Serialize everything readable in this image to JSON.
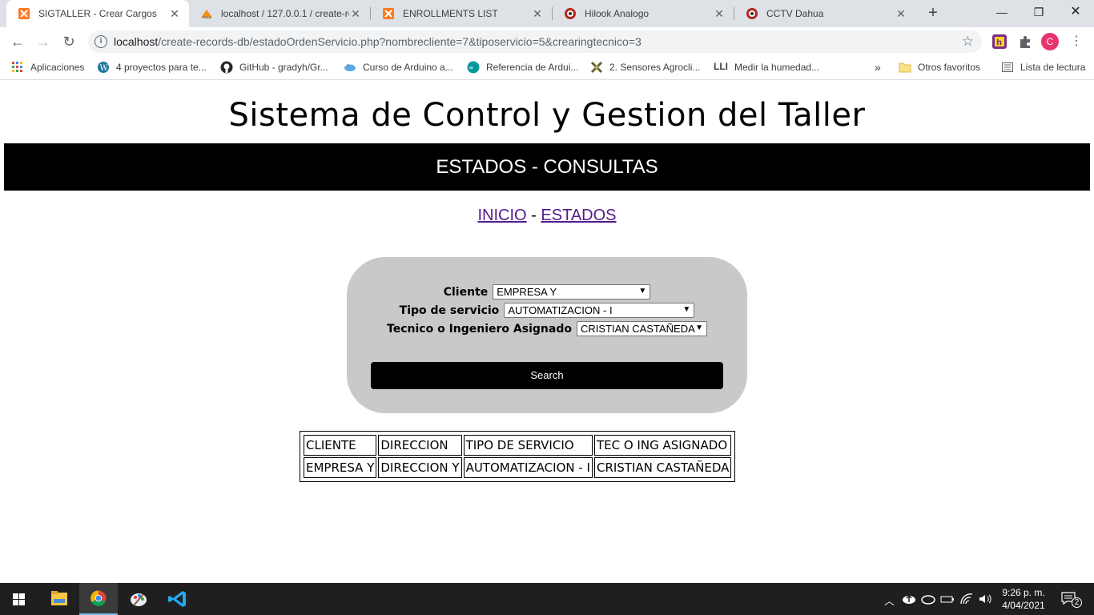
{
  "browser": {
    "tabs": [
      {
        "title": "SIGTALLER - Crear Cargos",
        "active": true,
        "icon": "xampp-icon"
      },
      {
        "title": "localhost / 127.0.0.1 / create-re",
        "active": false,
        "icon": "phpmyadmin-icon"
      },
      {
        "title": "ENROLLMENTS LIST",
        "active": false,
        "icon": "xampp-icon"
      },
      {
        "title": "Hilook Analogo",
        "active": false,
        "icon": "hikvision-icon"
      },
      {
        "title": "CCTV Dahua",
        "active": false,
        "icon": "hikvision-icon"
      }
    ],
    "url_host": "localhost",
    "url_path": "/create-records-db/estadoOrdenServicio.php?nombrecliente=7&tiposervicio=5&crearingtecnico=3",
    "profile_initial": "C",
    "bookmarks": [
      {
        "label": "Aplicaciones",
        "icon": "apps-grid-icon"
      },
      {
        "label": "4 proyectos para te...",
        "icon": "wordpress-icon"
      },
      {
        "label": "GitHub - gradyh/Gr...",
        "icon": "github-icon"
      },
      {
        "label": "Curso de Arduino a...",
        "icon": "cloud-link-icon"
      },
      {
        "label": "Referencia de Ardui...",
        "icon": "arduino-icon"
      },
      {
        "label": "2. Sensores Agrocli...",
        "icon": "sensor-icon"
      },
      {
        "label": "Medir la humedad...",
        "icon": "lli-icon"
      },
      {
        "label": "Otros favoritos",
        "icon": "folder-icon"
      },
      {
        "label": "Lista de lectura",
        "icon": "reading-list-icon"
      }
    ]
  },
  "page": {
    "title": "Sistema de Control y Gestion del Taller",
    "banner": "ESTADOS - CONSULTAS",
    "nav_inicio": "INICIO",
    "nav_sep": "-",
    "nav_estados": "ESTADOS",
    "form": {
      "cliente_label": "Cliente",
      "cliente_value": "EMPRESA Y",
      "tipo_label": "Tipo de servicio",
      "tipo_value": "AUTOMATIZACION - I",
      "tecnico_label": "Tecnico o Ingeniero Asignado",
      "tecnico_value": "CRISTIAN CASTAÑEDA",
      "search_label": "Search"
    },
    "table": {
      "headers": [
        "CLIENTE",
        "DIRECCION",
        "TIPO DE SERVICIO",
        "TEC O ING ASIGNADO"
      ],
      "rows": [
        [
          "EMPRESA Y",
          "DIRECCION Y",
          "AUTOMATIZACION - I",
          "CRISTIAN CASTAÑEDA"
        ]
      ]
    }
  },
  "taskbar": {
    "time": "9:26 p. m.",
    "date": "4/04/2021",
    "notifications": "2"
  }
}
